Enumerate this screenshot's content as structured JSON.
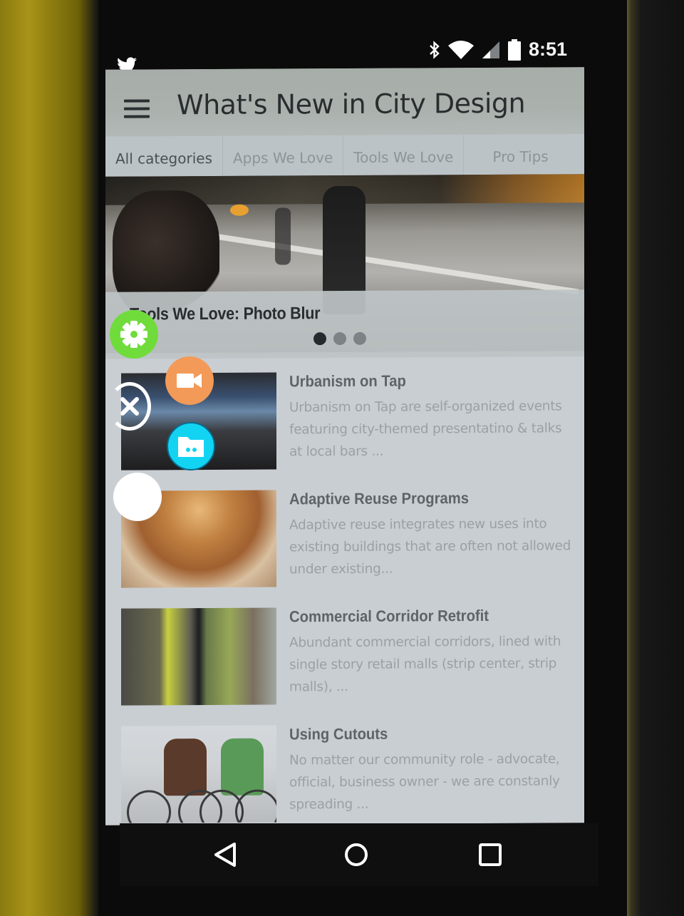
{
  "status_bar": {
    "notification_icons": [
      "twitter-icon"
    ],
    "system_icons": [
      "bluetooth-icon",
      "wifi-icon",
      "cell-signal-icon",
      "battery-icon"
    ],
    "time": "8:51"
  },
  "app_bar": {
    "menu_icon": "hamburger-menu-icon",
    "title": "What's New in City Design"
  },
  "tabs": [
    {
      "label": "All categories",
      "active": true
    },
    {
      "label": "Apps We Love",
      "active": false
    },
    {
      "label": "Tools We Love",
      "active": false
    },
    {
      "label": "Pro Tips",
      "active": false
    }
  ],
  "hero": {
    "caption": "Tools We Love: Photo Blur",
    "page_count": 3,
    "active_page": 1
  },
  "articles": [
    {
      "title": "Urbanism on Tap",
      "description": "Urbanism on Tap are self-organized events featuring city-themed presentatino & talks at local bars ..."
    },
    {
      "title": "Adaptive Reuse Programs",
      "description": "Adaptive reuse integrates new uses into existing buildings that are often not allowed under existing..."
    },
    {
      "title": "Commercial Corridor Retrofit",
      "description": "Abundant commercial corridors, lined with single story retail malls (strip center, strip malls), ..."
    },
    {
      "title": "Using Cutouts",
      "description": "No matter our community role  - advocate, official, business owner - we are constanly spreading ..."
    }
  ],
  "floating_menu": {
    "buttons": [
      {
        "icon": "gear-icon",
        "color": "#6fdc3c"
      },
      {
        "icon": "video-camera-icon",
        "color": "#f39a58"
      },
      {
        "icon": "close-icon",
        "color": "#ffffff"
      },
      {
        "icon": "folder-icon",
        "color": "#12d4f2"
      },
      {
        "icon": "blank-circle-icon",
        "color": "#ffffff"
      }
    ]
  },
  "nav_bar": {
    "buttons": [
      "back-icon",
      "home-icon",
      "recents-icon"
    ]
  }
}
